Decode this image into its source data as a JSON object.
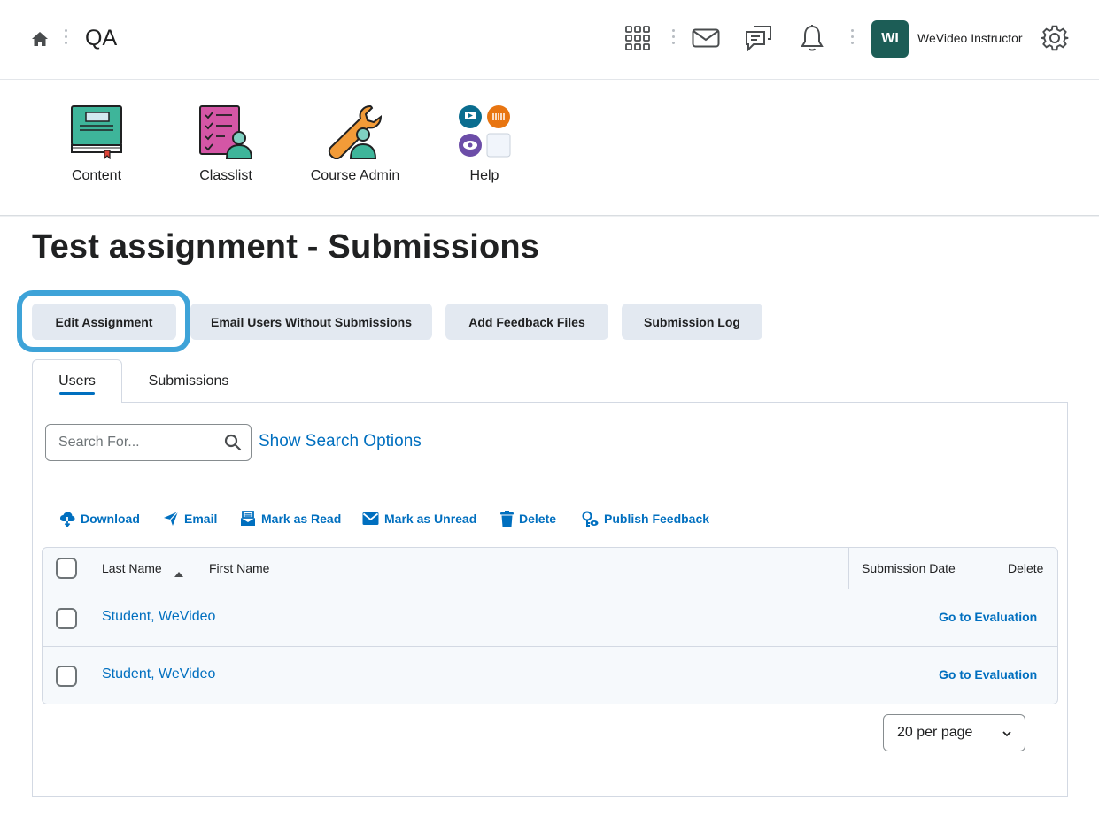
{
  "header": {
    "org_title": "QA",
    "avatar_initials": "WI",
    "user_name": "WeVideo Instructor",
    "icons": [
      "home-icon",
      "waffle-grid-icon",
      "mail-icon",
      "message-alerts-icon",
      "bell-icon",
      "gear-icon"
    ]
  },
  "nav": {
    "items": [
      {
        "label": "Content",
        "icon": "content-book-icon"
      },
      {
        "label": "Classlist",
        "icon": "classlist-icon"
      },
      {
        "label": "Course Admin",
        "icon": "course-admin-wrench-icon"
      },
      {
        "label": "Help",
        "icon": "help-tiles-icon"
      }
    ]
  },
  "page": {
    "title": "Test assignment - Submissions"
  },
  "buttons": {
    "edit": "Edit Assignment",
    "email_users": "Email Users Without Submissions",
    "add_feedback": "Add Feedback Files",
    "submission_log": "Submission Log"
  },
  "tabs": [
    {
      "label": "Users",
      "active": true
    },
    {
      "label": "Submissions",
      "active": false
    }
  ],
  "search": {
    "placeholder": "Search For...",
    "value": "",
    "show_options": "Show Search Options"
  },
  "actions": [
    {
      "label": "Download",
      "icon": "download-icon"
    },
    {
      "label": "Email",
      "icon": "send-email-icon"
    },
    {
      "label": "Mark as Read",
      "icon": "mark-read-icon"
    },
    {
      "label": "Mark as Unread",
      "icon": "mark-unread-icon"
    },
    {
      "label": "Delete",
      "icon": "trash-icon"
    },
    {
      "label": "Publish Feedback",
      "icon": "publish-feedback-icon"
    }
  ],
  "table": {
    "headers": {
      "last_name": "Last Name",
      "first_name": "First Name",
      "submission_date": "Submission Date",
      "delete": "Delete"
    },
    "sort": "ascending",
    "rows": [
      {
        "name": "Student, WeVideo",
        "action": "Go to Evaluation",
        "checked": false
      },
      {
        "name": "Student, WeVideo",
        "action": "Go to Evaluation",
        "checked": false
      }
    ]
  },
  "pager": {
    "per_page": "20 per page"
  },
  "colors": {
    "link": "#006fbf",
    "button_bg": "#e3e9f1",
    "focus_ring": "#3ea3d8",
    "avatar_bg": "#1c5d56"
  }
}
